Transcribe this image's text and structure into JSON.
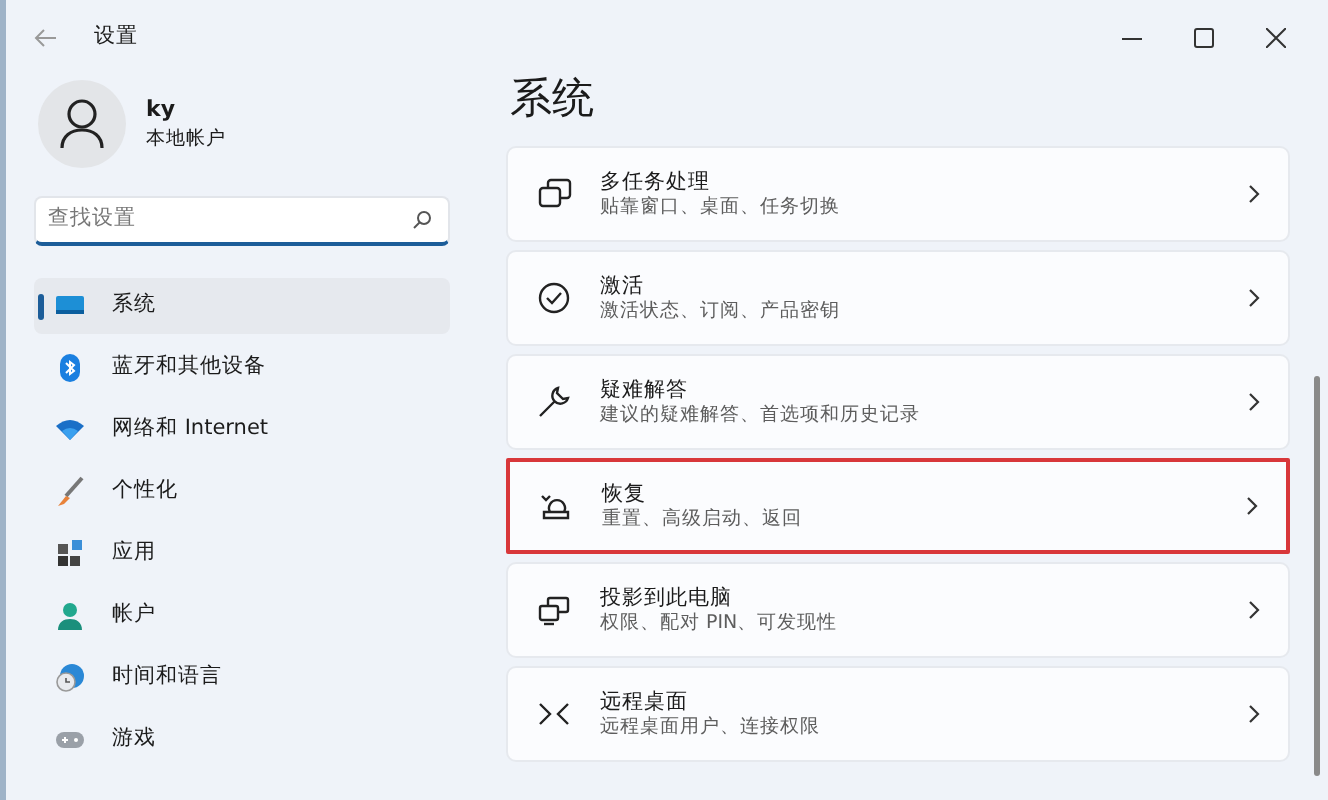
{
  "window": {
    "title": "设置"
  },
  "account": {
    "name": "ky",
    "type": "本地帐户"
  },
  "search": {
    "placeholder": "查找设置"
  },
  "sidebar": {
    "items": [
      {
        "label": "系统",
        "kind": "monitor",
        "selected": true
      },
      {
        "label": "蓝牙和其他设备",
        "kind": "bluetooth",
        "selected": false
      },
      {
        "label": "网络和 Internet",
        "kind": "wifi",
        "selected": false
      },
      {
        "label": "个性化",
        "kind": "brush",
        "selected": false
      },
      {
        "label": "应用",
        "kind": "apps",
        "selected": false
      },
      {
        "label": "帐户",
        "kind": "person",
        "selected": false
      },
      {
        "label": "时间和语言",
        "kind": "globe",
        "selected": false
      },
      {
        "label": "游戏",
        "kind": "gamepad",
        "selected": false
      }
    ]
  },
  "page": {
    "title": "系统",
    "settings": [
      {
        "title": "多任务处理",
        "subtitle": "贴靠窗口、桌面、任务切换",
        "kind": "windows",
        "highlighted": false
      },
      {
        "title": "激活",
        "subtitle": "激活状态、订阅、产品密钥",
        "kind": "check",
        "highlighted": false
      },
      {
        "title": "疑难解答",
        "subtitle": "建议的疑难解答、首选项和历史记录",
        "kind": "wrench",
        "highlighted": false
      },
      {
        "title": "恢复",
        "subtitle": "重置、高级启动、返回",
        "kind": "recovery",
        "highlighted": true
      },
      {
        "title": "投影到此电脑",
        "subtitle": "权限、配对 PIN、可发现性",
        "kind": "project",
        "highlighted": false
      },
      {
        "title": "远程桌面",
        "subtitle": "远程桌面用户、连接权限",
        "kind": "remote",
        "highlighted": false
      }
    ]
  }
}
